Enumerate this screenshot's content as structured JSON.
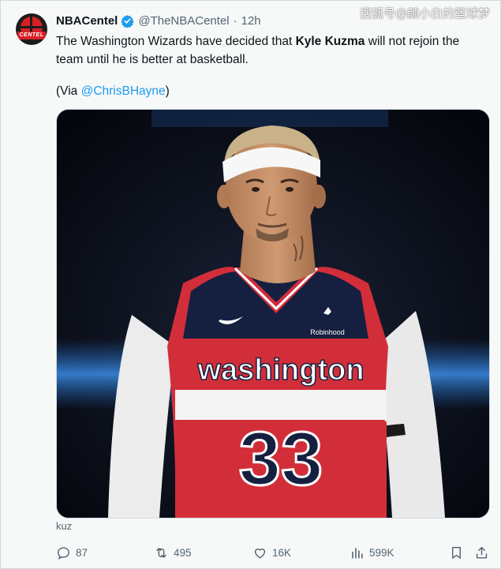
{
  "author": {
    "display_name": "NBACentel",
    "handle": "@TheNBACentel",
    "separator": "·",
    "time": "12h",
    "avatar_text": "CENTEL"
  },
  "watermark": "搜狐号@颜小白的篮球梦",
  "tweet": {
    "text_before": "The Washington Wizards have decided that ",
    "text_bold": "Kyle Kuzma",
    "text_after": " will not rejoin the team until he is better at basketball.",
    "via_prefix": "(Via ",
    "via_mention": "@ChrisBHayne",
    "via_suffix": ")"
  },
  "media": {
    "jersey_wordmark": "washington",
    "jersey_number": "33",
    "sponsor": "Robinhood"
  },
  "caption": "kuz",
  "actions": {
    "replies": "87",
    "retweets": "495",
    "likes": "16K",
    "views": "599K"
  },
  "colors": {
    "accent": "#1d9bf0",
    "jersey_red": "#d22e3a",
    "jersey_navy": "#152040"
  },
  "icons": [
    "verified-badge-icon",
    "reply-icon",
    "retweet-icon",
    "like-icon",
    "views-icon",
    "bookmark-icon",
    "share-icon"
  ]
}
